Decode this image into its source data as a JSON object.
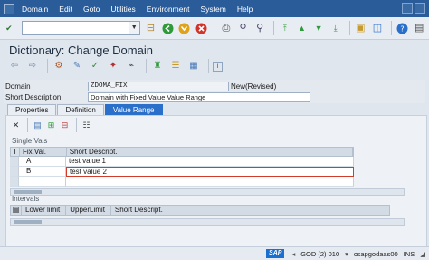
{
  "menu": {
    "items": [
      "Domain",
      "Edit",
      "Goto",
      "Utilities",
      "Environment",
      "System",
      "Help"
    ]
  },
  "title": "Dictionary: Change Domain",
  "header": {
    "domain_label": "Domain",
    "domain_value": "ZDOMA_FIX",
    "domain_status": "New(Revised)",
    "short_desc_label": "Short Description",
    "short_desc_value": "Domain with Fixed Value Value Range"
  },
  "tabs": [
    {
      "label": "Properties",
      "active": false
    },
    {
      "label": "Definition",
      "active": false
    },
    {
      "label": "Value Range",
      "active": true
    }
  ],
  "single_vals": {
    "section_label": "Single Vals",
    "columns": [
      "Fix.Val.",
      "Short Descript."
    ],
    "selector_header": "I",
    "rows": [
      {
        "fix": "A",
        "desc": "test value 1"
      },
      {
        "fix": "B",
        "desc": "test value 2"
      }
    ]
  },
  "intervals": {
    "section_label": "Intervals",
    "columns": [
      "Lower limit",
      "UpperLimit",
      "Short Descript."
    ]
  },
  "statusbar": {
    "logo": "SAP",
    "system": "GOD (2) 010",
    "server": "csapgodaas00",
    "mode": "INS"
  },
  "colors": {
    "menubar": "#2a5c9a",
    "active_tab": "#2a6fc9",
    "edit_border": "#d23a2a"
  },
  "icons": {
    "toolbar": [
      "check-icon",
      "save-icon",
      "back-icon",
      "exit-icon",
      "cancel-icon",
      "print-icon",
      "find-icon",
      "find-next-icon",
      "first-page-icon",
      "prev-page-icon",
      "next-page-icon",
      "last-page-icon",
      "new-session-icon",
      "shortcut-icon",
      "help-icon",
      "customize-icon"
    ]
  }
}
